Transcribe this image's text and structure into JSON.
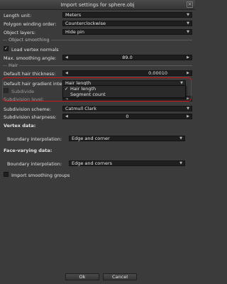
{
  "window": {
    "title": "Import settings for sphere.obj",
    "close_glyph": "×"
  },
  "length_unit": {
    "label": "Length unit:",
    "value": "Meters"
  },
  "winding_order": {
    "label": "Polygon winding order:",
    "value": "Counterclockwise"
  },
  "object_layers": {
    "label": "Object layers:",
    "value": "Hide pin"
  },
  "object_smoothing": {
    "section": "Object smoothing",
    "load_normals": {
      "label": "Load vertex normals",
      "checked": true
    },
    "max_angle": {
      "label": "Max. smoothing angle:",
      "value": "89.0"
    }
  },
  "hair": {
    "section": "Hair",
    "default_thickness": {
      "label": "Default hair thickness:",
      "value": "0.00010"
    },
    "gradient_interp": {
      "label": "Default hair gradient interpolation:",
      "value": "Hair length"
    },
    "subdivide_partial": "Subdivide",
    "subdivision_level_partial": "Subdivision level:"
  },
  "dropdown_options": [
    {
      "label": "Hair length",
      "selected": true,
      "mark": "✓"
    },
    {
      "label": "Segment count",
      "selected": false,
      "mark": ""
    }
  ],
  "subdivision_scheme": {
    "label": "Subdivision scheme:",
    "value": "Catmull Clark"
  },
  "subdivision_sharpness": {
    "label": "Subdivision sharpness:",
    "value": "0"
  },
  "vertex_data": {
    "heading": "Vertex data:",
    "boundary": {
      "label": "Boundary interpolation:",
      "value": "Edge and corner"
    }
  },
  "face_varying_data": {
    "heading": "Face-varying data:",
    "boundary": {
      "label": "Boundary interpolation:",
      "value": "Edge and corners"
    }
  },
  "import_smoothing_groups": {
    "label": "Import smoothing groups",
    "checked": false
  },
  "buttons": {
    "ok": "Ok",
    "cancel": "Cancel"
  },
  "colors": {
    "highlight": "#d01818",
    "background": "#3b3b3b",
    "field": "#1f1f1f"
  }
}
